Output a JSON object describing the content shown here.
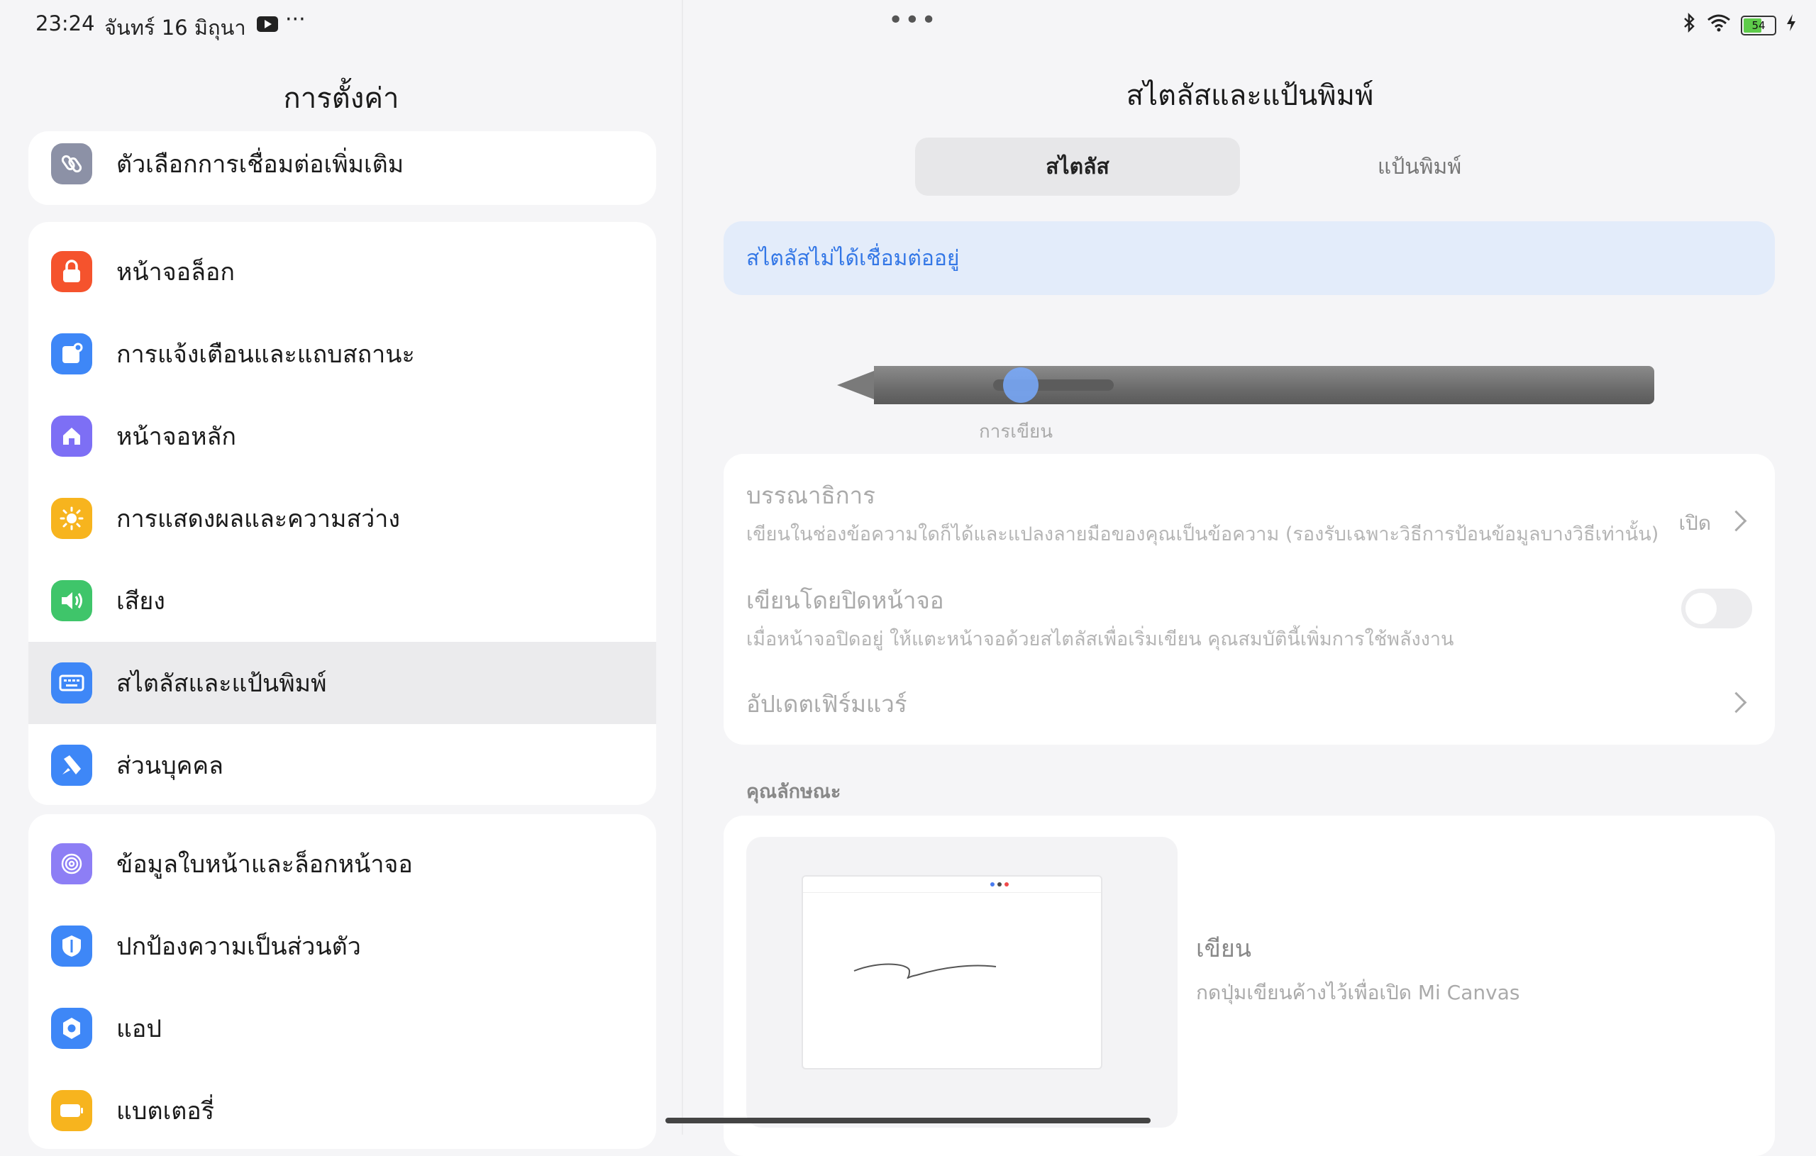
{
  "status": {
    "time": "23:24",
    "date": "จันทร์ 16 มิถุนา",
    "more": "···",
    "center_dots": "•••",
    "battery": "54"
  },
  "left": {
    "title": "การตั้งค่า",
    "groups": [
      {
        "items": [
          {
            "label": "ตัวเลือกการเชื่อมต่อเพิ่มเติม",
            "icon": "link-icon",
            "color": "#8c91a6"
          }
        ]
      },
      {
        "items": [
          {
            "label": "หน้าจอล็อก",
            "icon": "lock-icon",
            "color": "#f5532d"
          },
          {
            "label": "การแจ้งเตือนและแถบสถานะ",
            "icon": "notification-icon",
            "color": "#3e87f7"
          },
          {
            "label": "หน้าจอหลัก",
            "icon": "home-icon",
            "color": "#7d6ff5"
          },
          {
            "label": "การแสดงผลและความสว่าง",
            "icon": "sun-icon",
            "color": "#f7b41e"
          },
          {
            "label": "เสียง",
            "icon": "speaker-icon",
            "color": "#3fc56a"
          },
          {
            "label": "สไตลัสและแป้นพิมพ์",
            "icon": "keyboard-icon",
            "color": "#3e87f7"
          },
          {
            "label": "ส่วนบุคคล",
            "icon": "brush-icon",
            "color": "#3e87f7"
          }
        ]
      },
      {
        "items": [
          {
            "label": "ข้อมูลใบหน้าและล็อกหน้าจอ",
            "icon": "fingerprint-icon",
            "color": "#8d7ef5"
          },
          {
            "label": "ปกป้องความเป็นส่วนตัว",
            "icon": "privacy-icon",
            "color": "#3e87f7"
          },
          {
            "label": "แอป",
            "icon": "gear-icon",
            "color": "#3e87f7"
          },
          {
            "label": "แบตเตอรี่",
            "icon": "battery-icon",
            "color": "#f7b41e"
          }
        ]
      }
    ]
  },
  "right": {
    "title": "สไตลัสและแป้นพิมพ์",
    "tabs": {
      "stylus": "สไตลัส",
      "keyboard": "แป้นพิมพ์"
    },
    "banner": "สไตลัสไม่ได้เชื่อมต่ออยู่",
    "pen_caption": "การเขียน",
    "rows": {
      "handwriting_title": "บรรณาธิการ",
      "handwriting_sub": "เขียนในช่องข้อความใดก็ได้และแปลงลายมือของคุณเป็นข้อความ (รองรับเฉพาะวิธีการป้อนข้อมูลบางวิธีเท่านั้น)",
      "handwriting_value": "เปิด",
      "screen_off_title": "เขียนโดยปิดหน้าจอ",
      "screen_off_sub": "เมื่อหน้าจอปิดอยู่ ให้แตะหน้าจอด้วยสไตลัสเพื่อเริ่มเขียน คุณสมบัตินี้เพิ่มการใช้พลังงาน",
      "firmware_title": "อัปเดตเฟิร์มแวร์"
    },
    "section_label": "คุณลักษณะ",
    "feature": {
      "title": "เขียน",
      "subtitle": "กดปุ่มเขียนค้างไว้เพื่อเปิด Mi Canvas"
    }
  }
}
